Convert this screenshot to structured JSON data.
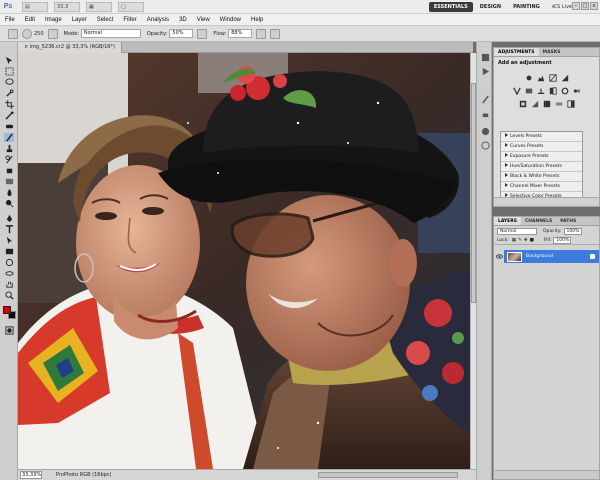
{
  "app": {
    "logo": "Ps"
  },
  "appbar": {
    "zoom_box": "33.3",
    "workspaces": [
      "ESSENTIALS",
      "DESIGN",
      "PAINTING",
      "»"
    ],
    "active_workspace": "ESSENTIALS",
    "cs_live": "CS Live",
    "window_buttons": [
      "–",
      "□",
      "x"
    ]
  },
  "menubar": {
    "items": [
      "File",
      "Edit",
      "Image",
      "Layer",
      "Select",
      "Filter",
      "Analysis",
      "3D",
      "View",
      "Window",
      "Help"
    ]
  },
  "options": {
    "brush_size": "250",
    "mode_label": "Mode:",
    "mode_value": "Normal",
    "opacity_label": "Opacity:",
    "opacity_value": "50%",
    "flow_label": "Flow:",
    "flow_value": "88%"
  },
  "document": {
    "tab_title": "img_5236.cr2 @ 33,3% (RGB/16*)",
    "tab_close": "×"
  },
  "status": {
    "zoom": "33,33%",
    "info": "ProPhoto RGB (16bpc)"
  },
  "adjustments": {
    "tabs": [
      "ADJUSTMENTS",
      "MASKS"
    ],
    "title": "Add an adjustment",
    "presets": [
      "Levels Presets",
      "Curves Presets",
      "Exposure Presets",
      "Hue/Saturation Presets",
      "Black & White Presets",
      "Channel Mixer Presets",
      "Selective Color Presets"
    ]
  },
  "layers": {
    "tabs": [
      "LAYERS",
      "CHANNELS",
      "PATHS"
    ],
    "blend_mode": "Normal",
    "opacity_label": "Opacity:",
    "opacity_value": "100%",
    "lock_label": "Lock:",
    "fill_label": "Fill:",
    "fill_value": "100%",
    "layer_name": "Background"
  },
  "colors": {
    "foreground": "#e00000",
    "background": "#000000",
    "selection": "#3d7bdc"
  }
}
